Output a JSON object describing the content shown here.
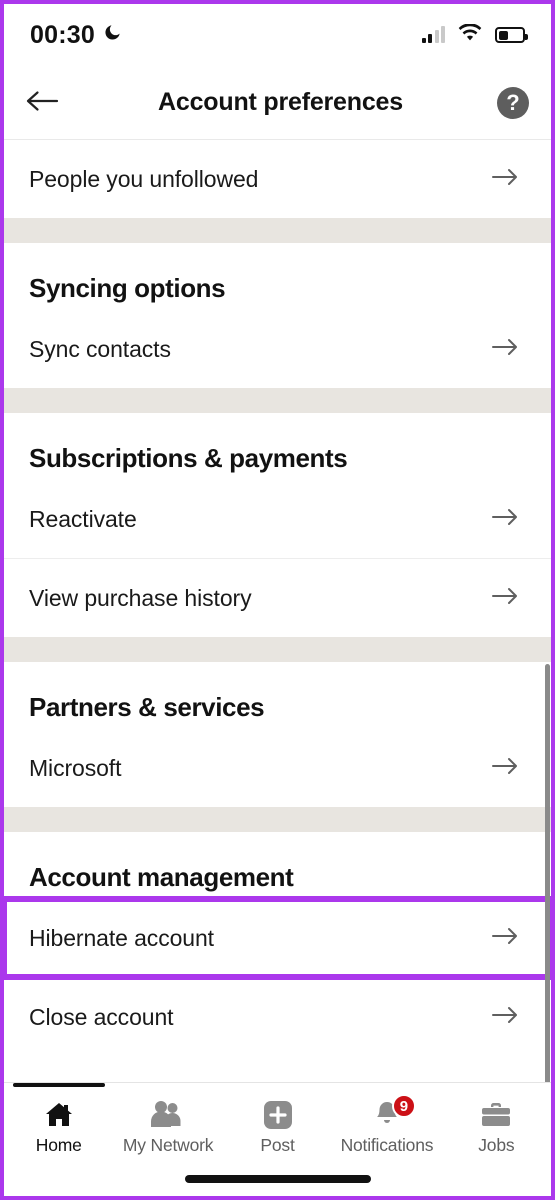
{
  "theme": {
    "highlight_color": "#ab38ec",
    "band_color": "#e8e5e0",
    "badge_color": "#cc1016",
    "arrow_color": "#5f5f5f",
    "icon_inactive_color": "#8c8c8c"
  },
  "status_bar": {
    "time": "00:30",
    "dnd_icon": "crescent-moon-icon",
    "signal_icon": "cellular-signal-icon",
    "signal_bars_filled": 2,
    "signal_bars_total": 4,
    "wifi_icon": "wifi-icon",
    "battery_icon": "battery-icon",
    "battery_level_percent": 40
  },
  "header": {
    "back_icon": "arrow-left-icon",
    "title": "Account preferences",
    "help_icon": "help-circle-icon",
    "help_glyph": "?"
  },
  "content": {
    "leading_rows": [
      {
        "label": "People you unfollowed",
        "icon": "arrow-right-icon"
      }
    ],
    "sections": [
      {
        "title": "Syncing options",
        "rows": [
          {
            "label": "Sync contacts",
            "icon": "arrow-right-icon",
            "highlighted": false
          }
        ]
      },
      {
        "title": "Subscriptions & payments",
        "rows": [
          {
            "label": "Reactivate",
            "icon": "arrow-right-icon",
            "highlighted": false
          },
          {
            "label": "View purchase history",
            "icon": "arrow-right-icon",
            "highlighted": false
          }
        ]
      },
      {
        "title": "Partners & services",
        "rows": [
          {
            "label": "Microsoft",
            "icon": "arrow-right-icon",
            "highlighted": false
          }
        ]
      },
      {
        "title": "Account management",
        "rows": [
          {
            "label": "Hibernate account",
            "icon": "arrow-right-icon",
            "highlighted": true
          },
          {
            "label": "Close account",
            "icon": "arrow-right-icon",
            "highlighted": false
          }
        ]
      }
    ],
    "scrollbar": {
      "name": "vertical-scrollbar",
      "visible": true
    }
  },
  "bottom_nav": {
    "tabs": [
      {
        "label": "Home",
        "icon": "home-icon",
        "active": true,
        "badge": null
      },
      {
        "label": "My Network",
        "icon": "people-icon",
        "active": false,
        "badge": null
      },
      {
        "label": "Post",
        "icon": "plus-square-icon",
        "active": false,
        "badge": null
      },
      {
        "label": "Notifications",
        "icon": "bell-icon",
        "active": false,
        "badge": "9"
      },
      {
        "label": "Jobs",
        "icon": "briefcase-icon",
        "active": false,
        "badge": null
      }
    ],
    "home_indicator": "home-indicator-bar"
  }
}
